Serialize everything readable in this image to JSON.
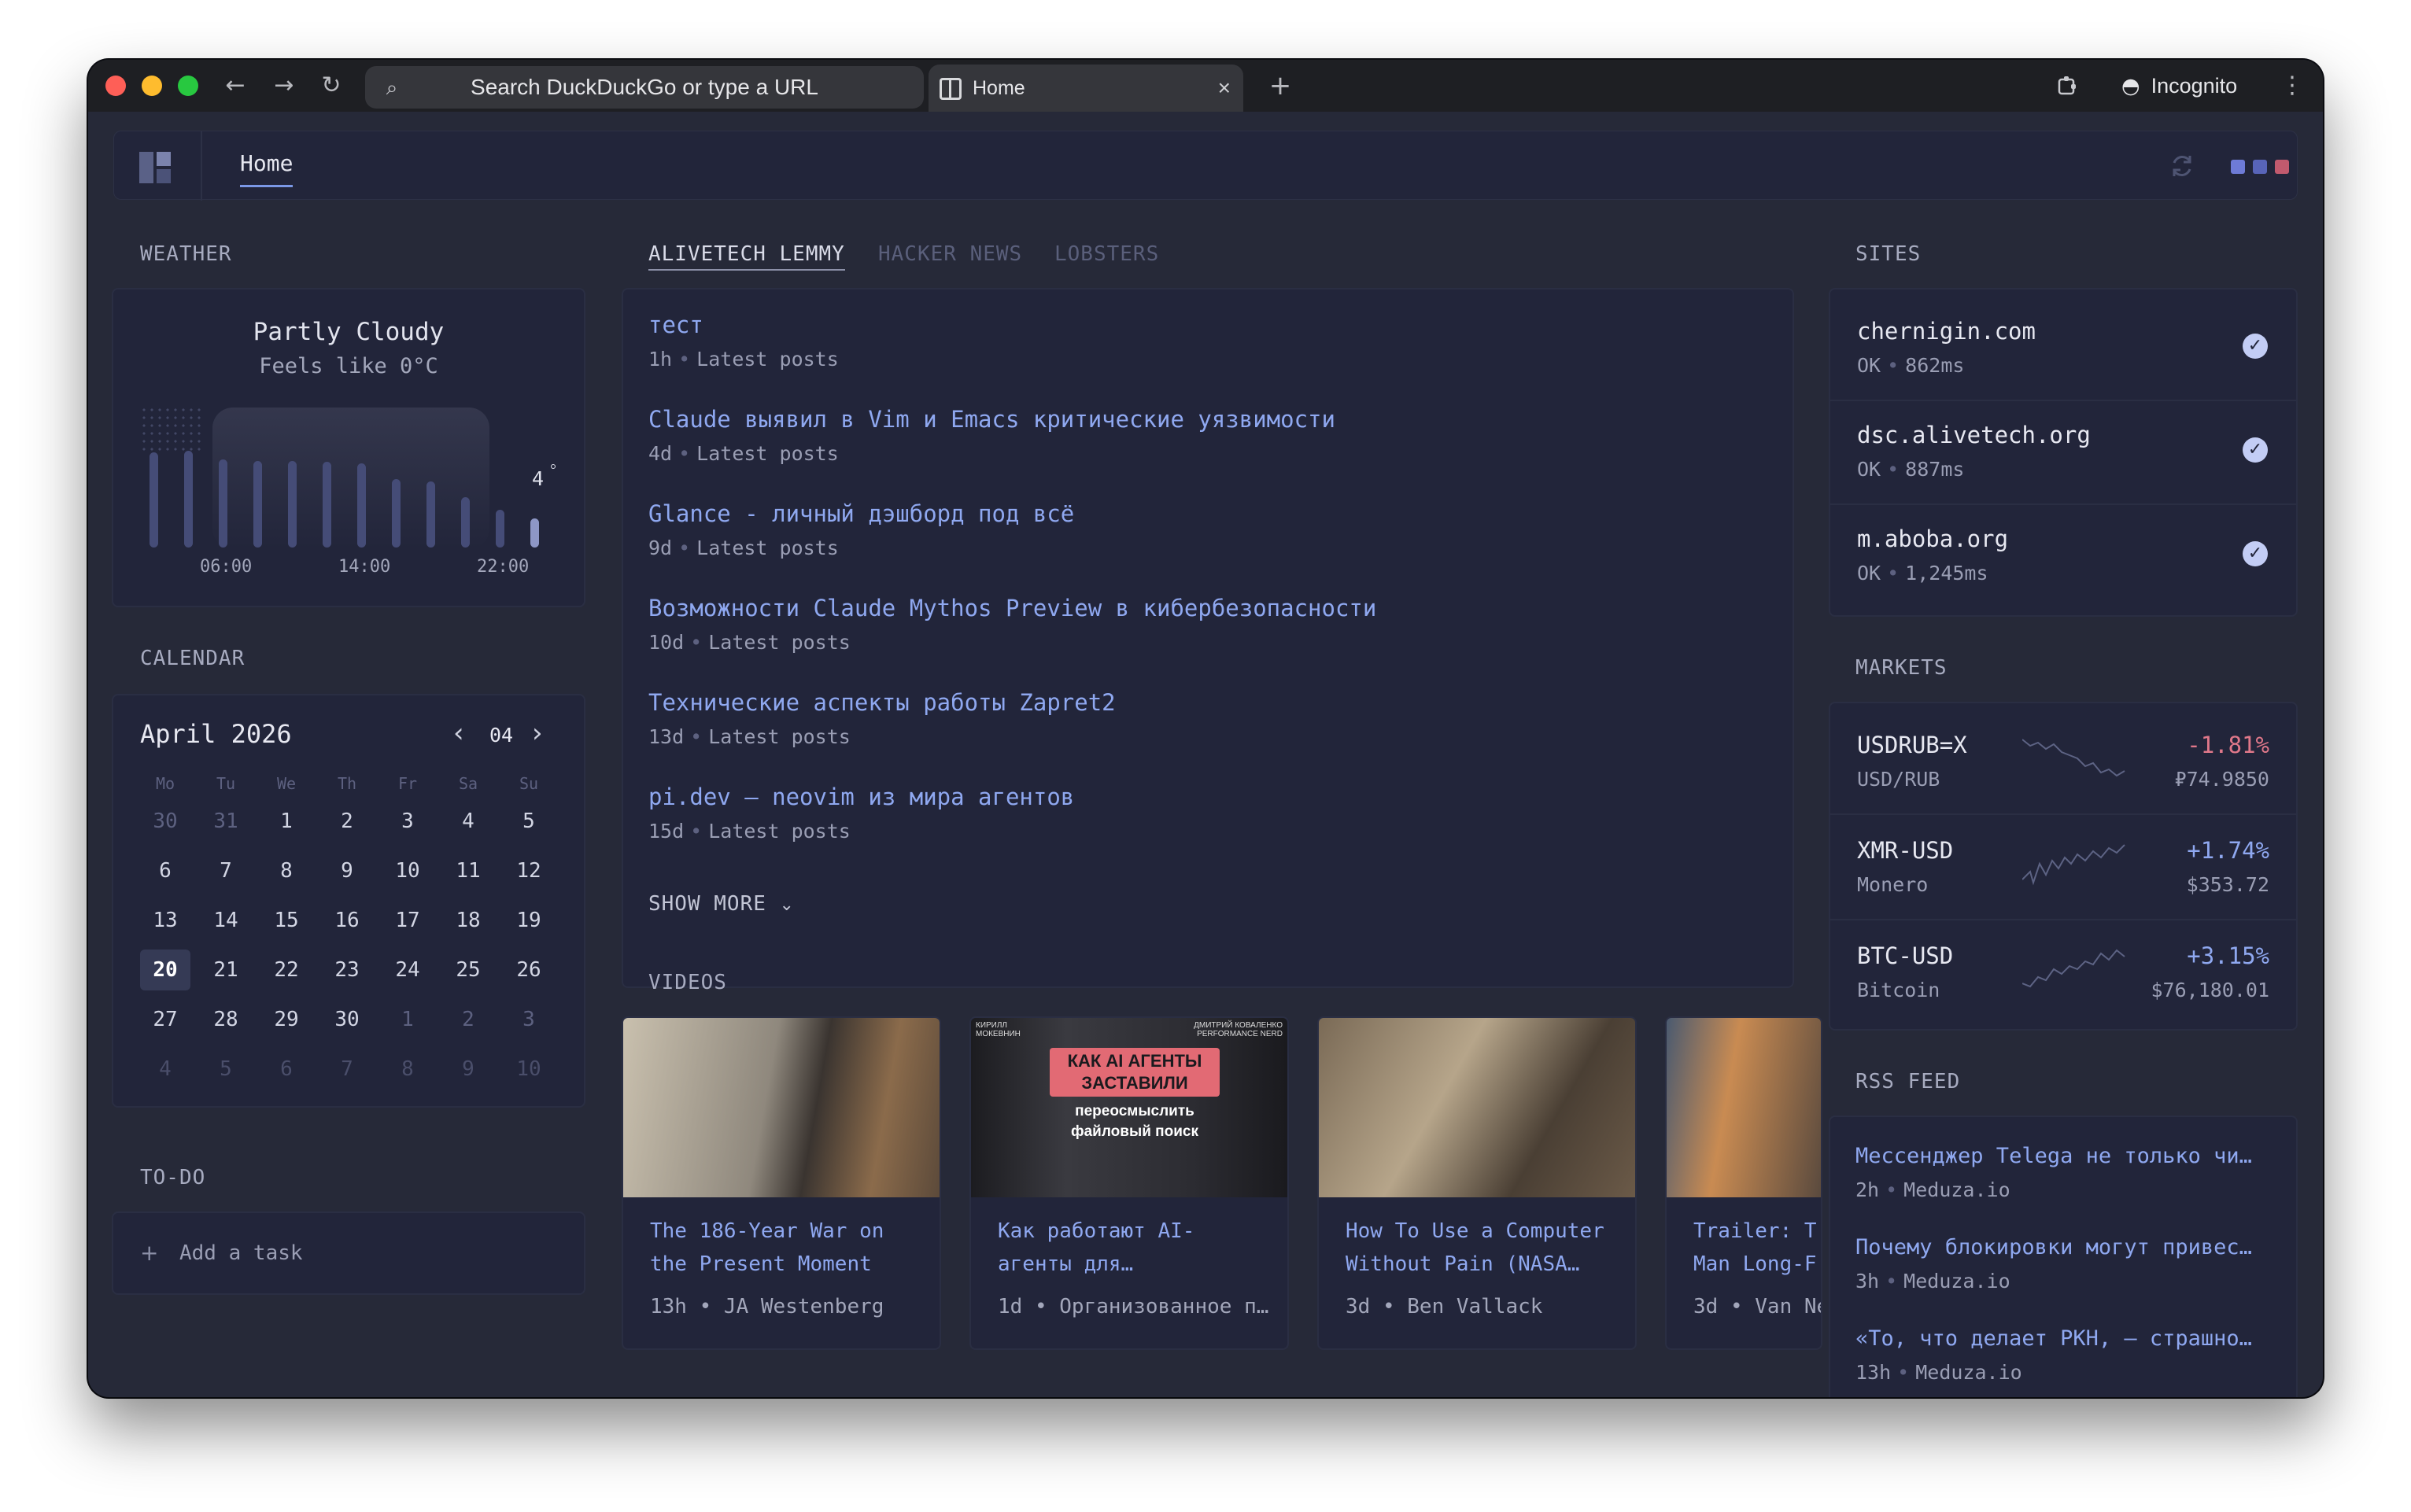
{
  "browser": {
    "search_placeholder": "Search DuckDuckGo or type a URL",
    "tab_title": "Home",
    "tab_close": "×",
    "new_tab": "+",
    "incognito": "Incognito",
    "back": "←",
    "forward": "→",
    "reload": "↻",
    "menu": "⋮"
  },
  "header": {
    "tab_home": "Home"
  },
  "weather": {
    "section": "WEATHER",
    "condition": "Partly Cloudy",
    "feels_like": "Feels like 0°C",
    "current_temp": "4",
    "time_labels": [
      "06:00",
      "14:00",
      "22:00"
    ],
    "bars": [
      0.68,
      0.69,
      0.63,
      0.62,
      0.62,
      0.61,
      0.6,
      0.49,
      0.47,
      0.36,
      0.27,
      0.21
    ]
  },
  "calendar": {
    "section": "CALENDAR",
    "month_label": "April 2026",
    "month_num": "04",
    "prev": "‹",
    "next": "›",
    "weekdays": [
      "Mo",
      "Tu",
      "We",
      "Th",
      "Fr",
      "Sa",
      "Su"
    ],
    "weeks": [
      [
        "30",
        "31",
        "1",
        "2",
        "3",
        "4",
        "5"
      ],
      [
        "6",
        "7",
        "8",
        "9",
        "10",
        "11",
        "12"
      ],
      [
        "13",
        "14",
        "15",
        "16",
        "17",
        "18",
        "19"
      ],
      [
        "20",
        "21",
        "22",
        "23",
        "24",
        "25",
        "26"
      ],
      [
        "27",
        "28",
        "29",
        "30",
        "1",
        "2",
        "3"
      ],
      [
        "4",
        "5",
        "6",
        "7",
        "8",
        "9",
        "10"
      ]
    ],
    "today": "20"
  },
  "todo": {
    "section": "TO-DO",
    "add_label": "Add a task",
    "plus": "+"
  },
  "feeds": {
    "tabs": [
      "ALIVETECH LEMMY",
      "HACKER NEWS",
      "LOBSTERS"
    ],
    "posts": [
      {
        "title": "тест",
        "age": "1h",
        "tag": "Latest posts"
      },
      {
        "title": "Claude выявил в Vim и Emacs критические уязвимости",
        "age": "4d",
        "tag": "Latest posts"
      },
      {
        "title": "Glance - личный дэшборд под всё",
        "age": "9d",
        "tag": "Latest posts"
      },
      {
        "title": "Возможности Claude Mythos Preview в кибербезопасности",
        "age": "10d",
        "tag": "Latest posts"
      },
      {
        "title": "Технические аспекты работы Zapret2",
        "age": "13d",
        "tag": "Latest posts"
      },
      {
        "title": "pi.dev — neovim из мира агентов",
        "age": "15d",
        "tag": "Latest posts"
      }
    ],
    "show_more": "SHOW MORE"
  },
  "videos": {
    "section": "VIDEOS",
    "items": [
      {
        "title": "The 186-Year War on\nthe Present Moment",
        "meta": "13h • JA Westenberg"
      },
      {
        "title": "Как работают AI-\nагенты для…",
        "meta": "1d • Организованное п…",
        "thumb_text": [
          "КАК AI АГЕНТЫ",
          "ЗАСТАВИЛИ",
          "переосмыслить",
          "файловый поиск"
        ],
        "thumb_names": [
          "КИРИЛЛ МОКЕВНИН",
          "ДМИТРИЙ КОВАЛЕНКО PERFORMANCE NERD"
        ]
      },
      {
        "title": "How To Use a Computer\nWithout Pain (NASA…",
        "meta": "3d • Ben Vallack"
      },
      {
        "title": "Trailer: T\nMan Long-F",
        "meta": "3d • Van Ne"
      }
    ]
  },
  "sites": {
    "section": "SITES",
    "items": [
      {
        "name": "chernigin.com",
        "status": "OK",
        "latency": "862ms"
      },
      {
        "name": "dsc.alivetech.org",
        "status": "OK",
        "latency": "887ms"
      },
      {
        "name": "m.aboba.org",
        "status": "OK",
        "latency": "1,245ms"
      }
    ]
  },
  "markets": {
    "section": "MARKETS",
    "items": [
      {
        "symbol": "USDRUB=X",
        "name": "USD/RUB",
        "change": "-1.81%",
        "price": "₽74.9850",
        "up": false
      },
      {
        "symbol": "XMR-USD",
        "name": "Monero",
        "change": "+1.74%",
        "price": "$353.72",
        "up": true
      },
      {
        "symbol": "BTC-USD",
        "name": "Bitcoin",
        "change": "+3.15%",
        "price": "$76,180.01",
        "up": true
      }
    ]
  },
  "rss": {
    "section": "RSS FEED",
    "items": [
      {
        "title": "Мессенджер Telega не только чи…",
        "age": "2h",
        "source": "Meduza.io"
      },
      {
        "title": "Почему блокировки могут привес…",
        "age": "3h",
        "source": "Meduza.io"
      },
      {
        "title": "«То, что делает РКН, — страшно…",
        "age": "13h",
        "source": "Meduza.io"
      }
    ]
  },
  "colors": {
    "bg": "#262938",
    "card": "#22253a",
    "accent": "#8fa8f0",
    "negative": "#e0788a",
    "positive": "#8fa8f0"
  }
}
